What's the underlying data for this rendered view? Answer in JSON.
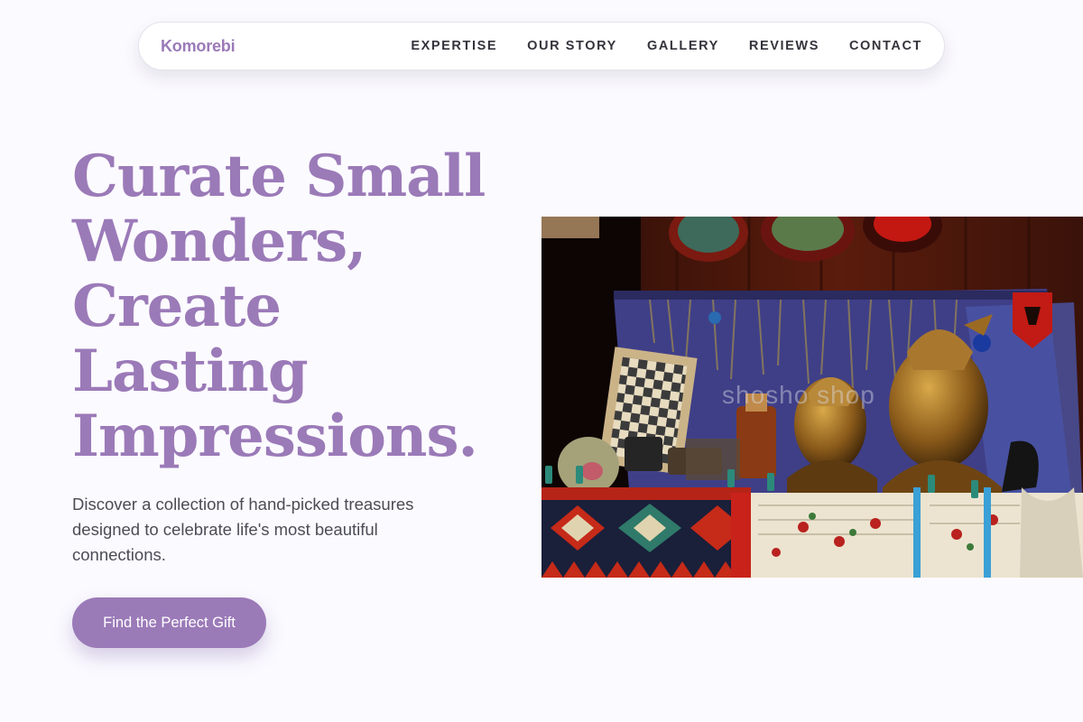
{
  "nav": {
    "brand": "Komorebi",
    "links": [
      "EXPERTISE",
      "OUR STORY",
      "GALLERY",
      "REVIEWS",
      "CONTACT"
    ]
  },
  "hero": {
    "title_lines": [
      "Curate Small",
      "Wonders,",
      "Create",
      "Lasting",
      "Impressions."
    ],
    "subtitle": "Discover a collection of hand-picked treasures designed to celebrate life's most beautiful connections.",
    "cta_label": "Find the Perfect Gift",
    "image_watermark": "shosho shop"
  },
  "colors": {
    "accent": "#9b7ab8",
    "background": "#fbfaff",
    "text": "#34343c"
  }
}
